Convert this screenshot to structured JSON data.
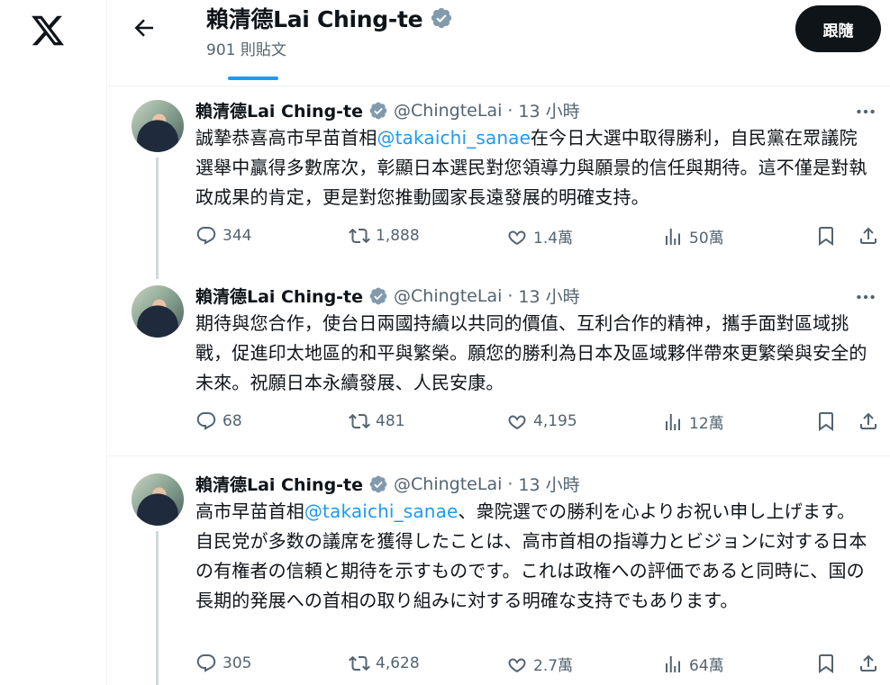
{
  "header": {
    "title": "賴清德Lai Ching-te",
    "post_count": "901 則貼文",
    "follow_label": "跟隨"
  },
  "colors": {
    "accent": "#1d9bf0",
    "text": "#0f1419",
    "muted": "#536471",
    "verified": "#829aab"
  },
  "icons": [
    "x-logo-icon",
    "back-arrow-icon",
    "verified-icon",
    "more-icon",
    "reply-icon",
    "retweet-icon",
    "like-icon",
    "views-icon",
    "bookmark-icon",
    "share-icon"
  ],
  "tweets": [
    {
      "name": "賴清德Lai Ching-te",
      "handle": "@ChingteLai",
      "dot": "·",
      "time": "13 小時",
      "text_before": "誠摯恭喜高市早苗首相",
      "mention": "@takaichi_sanae",
      "text_after": "在今日大選中取得勝利，自民黨在眾議院選舉中贏得多數席次，彰顯日本選民對您領導力與願景的信任與期待。這不僅是對執政成果的肯定，更是對您推動國家長遠發展的明確支持。",
      "replies": "344",
      "retweets": "1,888",
      "likes": "1.4萬",
      "views": "50萬"
    },
    {
      "name": "賴清德Lai Ching-te",
      "handle": "@ChingteLai",
      "dot": "·",
      "time": "13 小時",
      "text_before": "期待與您合作，使台日兩國持續以共同的價值、互利合作的精神，攜手面對區域挑戰，促進印太地區的和平與繁榮。願您的勝利為日本及區域夥伴帶來更繁榮與安全的未來。祝願日本永續發展、人民安康。",
      "mention": "",
      "text_after": "",
      "replies": "68",
      "retweets": "481",
      "likes": "4,195",
      "views": "12萬"
    },
    {
      "name": "賴清德Lai Ching-te",
      "handle": "@ChingteLai",
      "dot": "·",
      "time": "13 小時",
      "text_before": "高市早苗首相",
      "mention": "@takaichi_sanae",
      "text_after": "、衆院選での勝利を心よりお祝い申し上げます。自民党が多数の議席を獲得したことは、高市首相の指導力とビジョンに対する日本の有権者の信頼と期待を示すものです。これは政権への評価であると同時に、国の長期的発展への首相の取り組みに対する明確な支持でもあります。",
      "replies": "305",
      "retweets": "4,628",
      "likes": "2.7萬",
      "views": "64萬"
    }
  ]
}
